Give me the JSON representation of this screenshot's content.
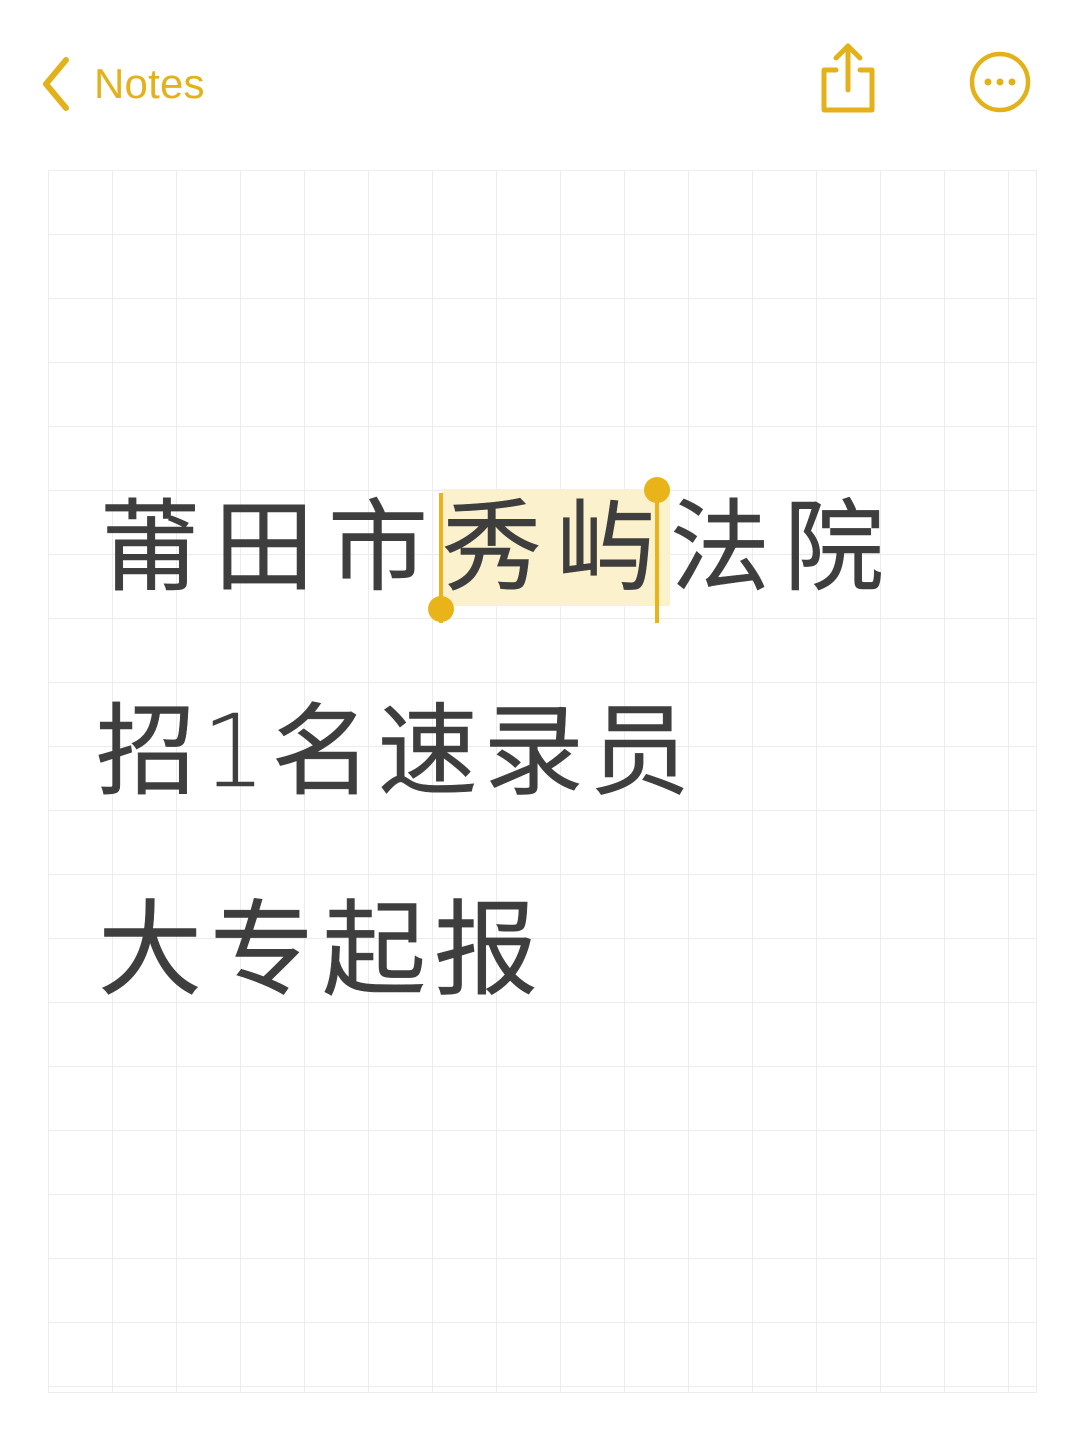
{
  "nav": {
    "back_label": "Notes",
    "accent_color": "#e3b21a",
    "icons": [
      "chevron-left-icon",
      "share-icon",
      "more-icon"
    ]
  },
  "note": {
    "line1": {
      "before": "莆田市",
      "selected": "秀屿",
      "after": "法院"
    },
    "line2": "招1名速录员",
    "line3": "大专起报",
    "selection_color": "#fbf1cc",
    "text_color": "#3e3e3e"
  }
}
